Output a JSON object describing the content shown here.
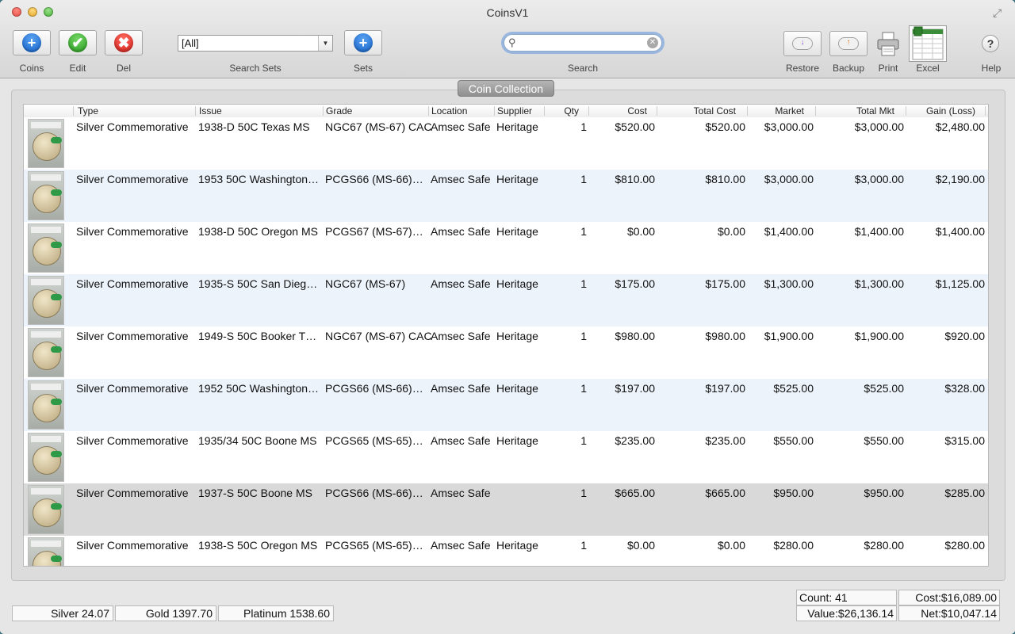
{
  "window": {
    "title": "CoinsV1"
  },
  "toolbar": {
    "coins_label": "Coins",
    "edit_label": "Edit",
    "del_label": "Del",
    "set_selected": "[All]",
    "search_sets_label": "Search Sets",
    "sets_label": "Sets",
    "search_value": "",
    "search_label": "Search",
    "restore_label": "Restore",
    "backup_label": "Backup",
    "print_label": "Print",
    "excel_label": "Excel",
    "help_label": "Help",
    "help_glyph": "?",
    "plus_glyph": "+",
    "check_glyph": "✔",
    "x_glyph": "✖"
  },
  "panel": {
    "title": "Coin Collection"
  },
  "table": {
    "columns": [
      "Type",
      "Issue",
      "Grade",
      "Location",
      "Supplier",
      "Qty",
      "Cost",
      "Total Cost",
      "Market",
      "Total Mkt",
      "Gain (Loss)"
    ],
    "rows": [
      [
        "Silver Commemorative",
        "1938-D 50C Texas MS",
        "NGC67 (MS-67) CAC",
        "Amsec Safe",
        "Heritage",
        "1",
        "$520.00",
        "$520.00",
        "$3,000.00",
        "$3,000.00",
        "$2,480.00"
      ],
      [
        "Silver Commemorative",
        "1953 50C Washington…",
        "PCGS66 (MS-66)…",
        "Amsec Safe",
        "Heritage",
        "1",
        "$810.00",
        "$810.00",
        "$3,000.00",
        "$3,000.00",
        "$2,190.00"
      ],
      [
        "Silver Commemorative",
        "1938-D 50C Oregon MS",
        "PCGS67 (MS-67)…",
        "Amsec Safe",
        "Heritage",
        "1",
        "$0.00",
        "$0.00",
        "$1,400.00",
        "$1,400.00",
        "$1,400.00"
      ],
      [
        "Silver Commemorative",
        "1935-S 50C San Dieg…",
        "NGC67 (MS-67)",
        "Amsec Safe",
        "Heritage",
        "1",
        "$175.00",
        "$175.00",
        "$1,300.00",
        "$1,300.00",
        "$1,125.00"
      ],
      [
        "Silver Commemorative",
        "1949-S 50C Booker T…",
        "NGC67 (MS-67) CAC",
        "Amsec Safe",
        "Heritage",
        "1",
        "$980.00",
        "$980.00",
        "$1,900.00",
        "$1,900.00",
        "$920.00"
      ],
      [
        "Silver Commemorative",
        "1952 50C Washington…",
        "PCGS66 (MS-66)…",
        "Amsec Safe",
        "Heritage",
        "1",
        "$197.00",
        "$197.00",
        "$525.00",
        "$525.00",
        "$328.00"
      ],
      [
        "Silver Commemorative",
        "1935/34 50C Boone MS",
        "PCGS65 (MS-65)…",
        "Amsec Safe",
        "Heritage",
        "1",
        "$235.00",
        "$235.00",
        "$550.00",
        "$550.00",
        "$315.00"
      ],
      [
        "Silver Commemorative",
        "1937-S 50C Boone MS",
        "PCGS66 (MS-66)…",
        "Amsec Safe",
        "",
        "1",
        "$665.00",
        "$665.00",
        "$950.00",
        "$950.00",
        "$285.00"
      ],
      [
        "Silver Commemorative",
        "1938-S 50C Oregon MS",
        "PCGS65 (MS-65)…",
        "Amsec Safe",
        "Heritage",
        "1",
        "$0.00",
        "$0.00",
        "$280.00",
        "$280.00",
        "$280.00"
      ]
    ],
    "selected_row": 7
  },
  "status": {
    "silver": "Silver 24.07",
    "gold": "Gold 1397.70",
    "platinum": "Platinum 1538.60",
    "count": "Count: 41",
    "cost": "Cost:$16,089.00",
    "value": "Value:$26,136.14",
    "net": "Net:$10,047.14"
  }
}
